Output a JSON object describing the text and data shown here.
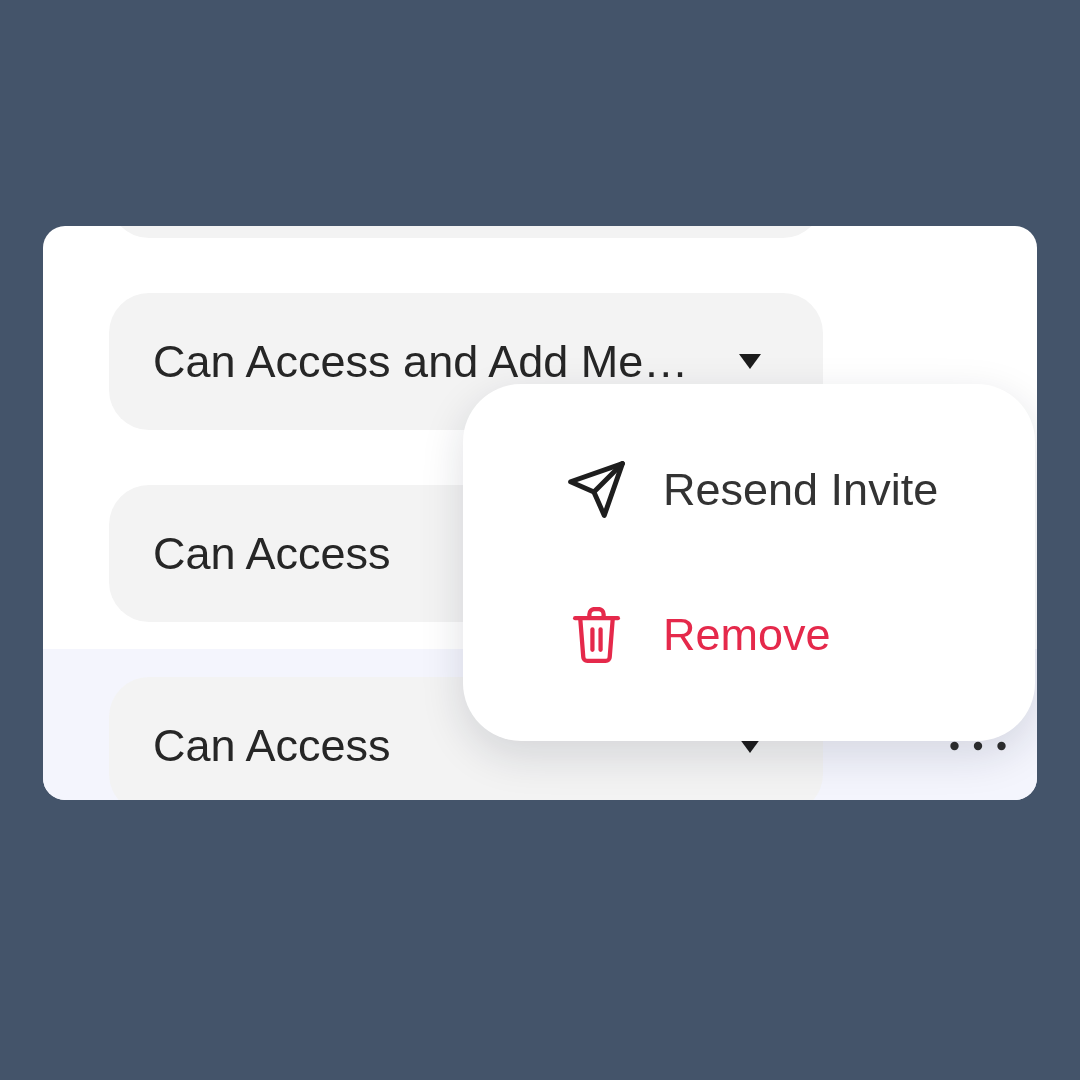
{
  "rows": [
    {
      "permission": "Can Access and Add Me…",
      "selected": false
    },
    {
      "permission": "Can Access",
      "selected": false
    },
    {
      "permission": "Can Access",
      "selected": true
    }
  ],
  "menu": {
    "items": [
      {
        "kind": "send",
        "label": "Resend Invite"
      },
      {
        "kind": "delete",
        "label": "Remove"
      }
    ]
  }
}
